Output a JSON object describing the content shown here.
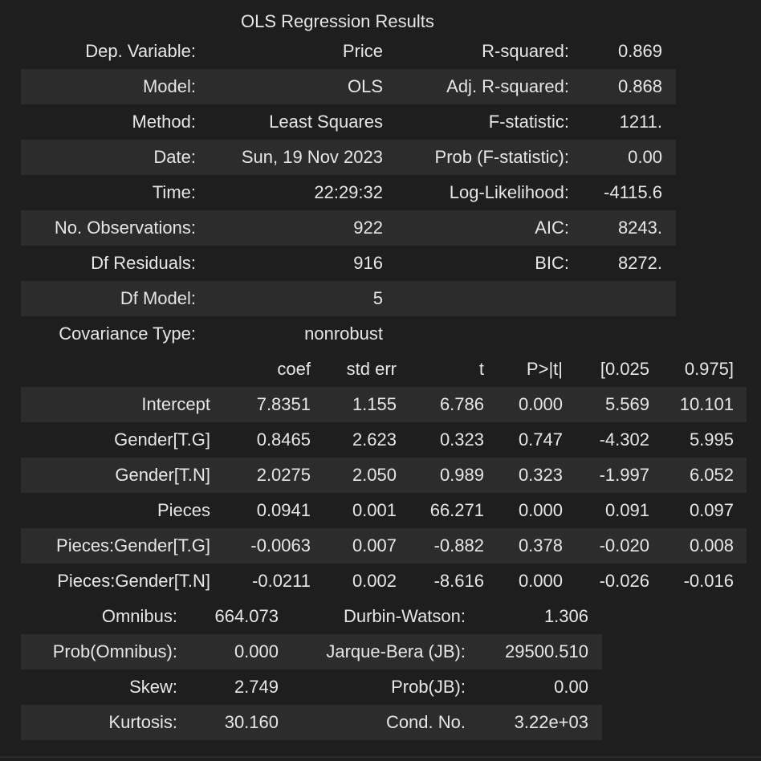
{
  "caption": "OLS Regression Results",
  "summary": {
    "rows": [
      {
        "l1": "Dep. Variable:",
        "v1": "Price",
        "l2": "R-squared:",
        "v2": "0.869"
      },
      {
        "l1": "Model:",
        "v1": "OLS",
        "l2": "Adj. R-squared:",
        "v2": "0.868"
      },
      {
        "l1": "Method:",
        "v1": "Least Squares",
        "l2": "F-statistic:",
        "v2": "1211."
      },
      {
        "l1": "Date:",
        "v1": "Sun, 19 Nov 2023",
        "l2": "Prob (F-statistic):",
        "v2": "0.00"
      },
      {
        "l1": "Time:",
        "v1": "22:29:32",
        "l2": "Log-Likelihood:",
        "v2": "-4115.6"
      },
      {
        "l1": "No. Observations:",
        "v1": "922",
        "l2": "AIC:",
        "v2": "8243."
      },
      {
        "l1": "Df Residuals:",
        "v1": "916",
        "l2": "BIC:",
        "v2": "8272."
      },
      {
        "l1": "Df Model:",
        "v1": "5",
        "l2": "",
        "v2": ""
      },
      {
        "l1": "Covariance Type:",
        "v1": "nonrobust",
        "l2": "",
        "v2": ""
      }
    ]
  },
  "coefficients": {
    "headers": [
      "",
      "coef",
      "std err",
      "t",
      "P>|t|",
      "[0.025",
      "0.975]"
    ],
    "rows": [
      [
        "Intercept",
        "7.8351",
        "1.155",
        "6.786",
        "0.000",
        "5.569",
        "10.101"
      ],
      [
        "Gender[T.G]",
        "0.8465",
        "2.623",
        "0.323",
        "0.747",
        "-4.302",
        "5.995"
      ],
      [
        "Gender[T.N]",
        "2.0275",
        "2.050",
        "0.989",
        "0.323",
        "-1.997",
        "6.052"
      ],
      [
        "Pieces",
        "0.0941",
        "0.001",
        "66.271",
        "0.000",
        "0.091",
        "0.097"
      ],
      [
        "Pieces:Gender[T.G]",
        "-0.0063",
        "0.007",
        "-0.882",
        "0.378",
        "-0.020",
        "0.008"
      ],
      [
        "Pieces:Gender[T.N]",
        "-0.0211",
        "0.002",
        "-8.616",
        "0.000",
        "-0.026",
        "-0.016"
      ]
    ]
  },
  "diagnostics": {
    "rows": [
      {
        "l1": "Omnibus:",
        "v1": "664.073",
        "l2": "Durbin-Watson:",
        "v2": "1.306"
      },
      {
        "l1": "Prob(Omnibus):",
        "v1": "0.000",
        "l2": "Jarque-Bera (JB):",
        "v2": "29500.510"
      },
      {
        "l1": "Skew:",
        "v1": "2.749",
        "l2": "Prob(JB):",
        "v2": "0.00"
      },
      {
        "l1": "Kurtosis:",
        "v1": "30.160",
        "l2": "Cond. No.",
        "v2": "3.22e+03"
      }
    ]
  },
  "colors": {
    "background": "#1e1e1e",
    "stripe": "#2c2c2c",
    "text": "#e6e6e6"
  }
}
